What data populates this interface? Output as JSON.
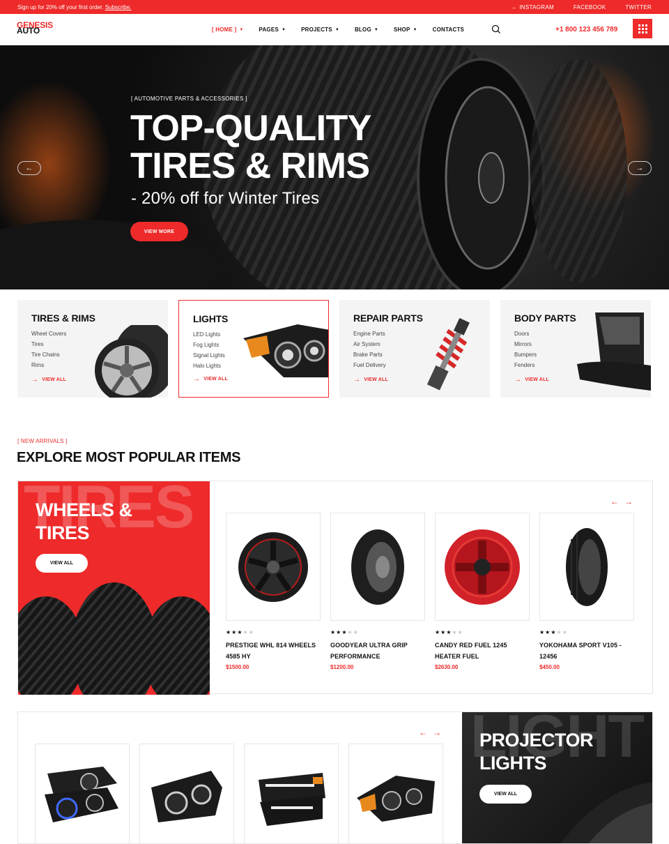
{
  "topbar": {
    "promo_text": "Sign up for 20% off your first order.",
    "promo_link": "Subscribe.",
    "social": [
      "INSTAGRAM",
      "FACEBOOK",
      "TWITTER"
    ]
  },
  "header": {
    "logo_top": "GENESIS",
    "logo_bottom": "AUTO",
    "nav": [
      {
        "label": "[ HOME ]",
        "active": true
      },
      {
        "label": "PAGES"
      },
      {
        "label": "PROJECTS"
      },
      {
        "label": "BLOG"
      },
      {
        "label": "SHOP"
      },
      {
        "label": "CONTACTS"
      }
    ],
    "phone": "+1 800 123 456 789"
  },
  "hero": {
    "kicker": "[ AUTOMOTIVE PARTS & ACCESSORIES ]",
    "title_line1": "TOP-QUALITY",
    "title_line2": "TIRES & RIMS",
    "subtitle": "- 20% off for Winter Tires",
    "cta": "VIEW MORE"
  },
  "categories": [
    {
      "title": "TIRES & RIMS",
      "items": [
        "Wheel Covers",
        "Tires",
        "Tire Chains",
        "Rims"
      ],
      "link": "VIEW ALL"
    },
    {
      "title": "LIGHTS",
      "items": [
        "LED Lights",
        "Fog Lights",
        "Signal Lights",
        "Halo Lights"
      ],
      "link": "VIEW ALL"
    },
    {
      "title": "REPAIR PARTS",
      "items": [
        "Engine Parts",
        "Air System",
        "Brake Parts",
        "Fuel Delivery"
      ],
      "link": "VIEW ALL"
    },
    {
      "title": "BODY PARTS",
      "items": [
        "Doors",
        "Mirrors",
        "Bumpers",
        "Fenders"
      ],
      "link": "VIEW ALL"
    }
  ],
  "popular": {
    "kicker": "[ NEW ARRIVALS ]",
    "title": "EXPLORE MOST POPULAR ITEMS"
  },
  "wheels_promo": {
    "ghost": "TIRES",
    "title_line1": "WHEELS &",
    "title_line2": "TIRES",
    "button": "VIEW ALL"
  },
  "wheels_products": [
    {
      "name_line1": "PRESTIGE WHL 814 WHEELS",
      "name_line2": "4585 HY",
      "price": "$1500.00",
      "rating": 3
    },
    {
      "name_line1": "GOODYEAR ULTRA GRIP",
      "name_line2": "PERFORMANCE",
      "price": "$1200.00",
      "rating": 3
    },
    {
      "name_line1": "CANDY RED FUEL 1245",
      "name_line2": "HEATER FUEL",
      "price": "$2630.00",
      "rating": 3
    },
    {
      "name_line1": "YOKOHAMA SPORT V105 -",
      "name_line2": "12456",
      "price": "$450.00",
      "rating": 3
    }
  ],
  "lights_promo": {
    "ghost": "LIGHT",
    "title_line1": "PROJECTOR",
    "title_line2": "LIGHTS",
    "button": "VIEW ALL"
  },
  "colors": {
    "accent": "#ee2a2a",
    "dark": "#111111"
  }
}
